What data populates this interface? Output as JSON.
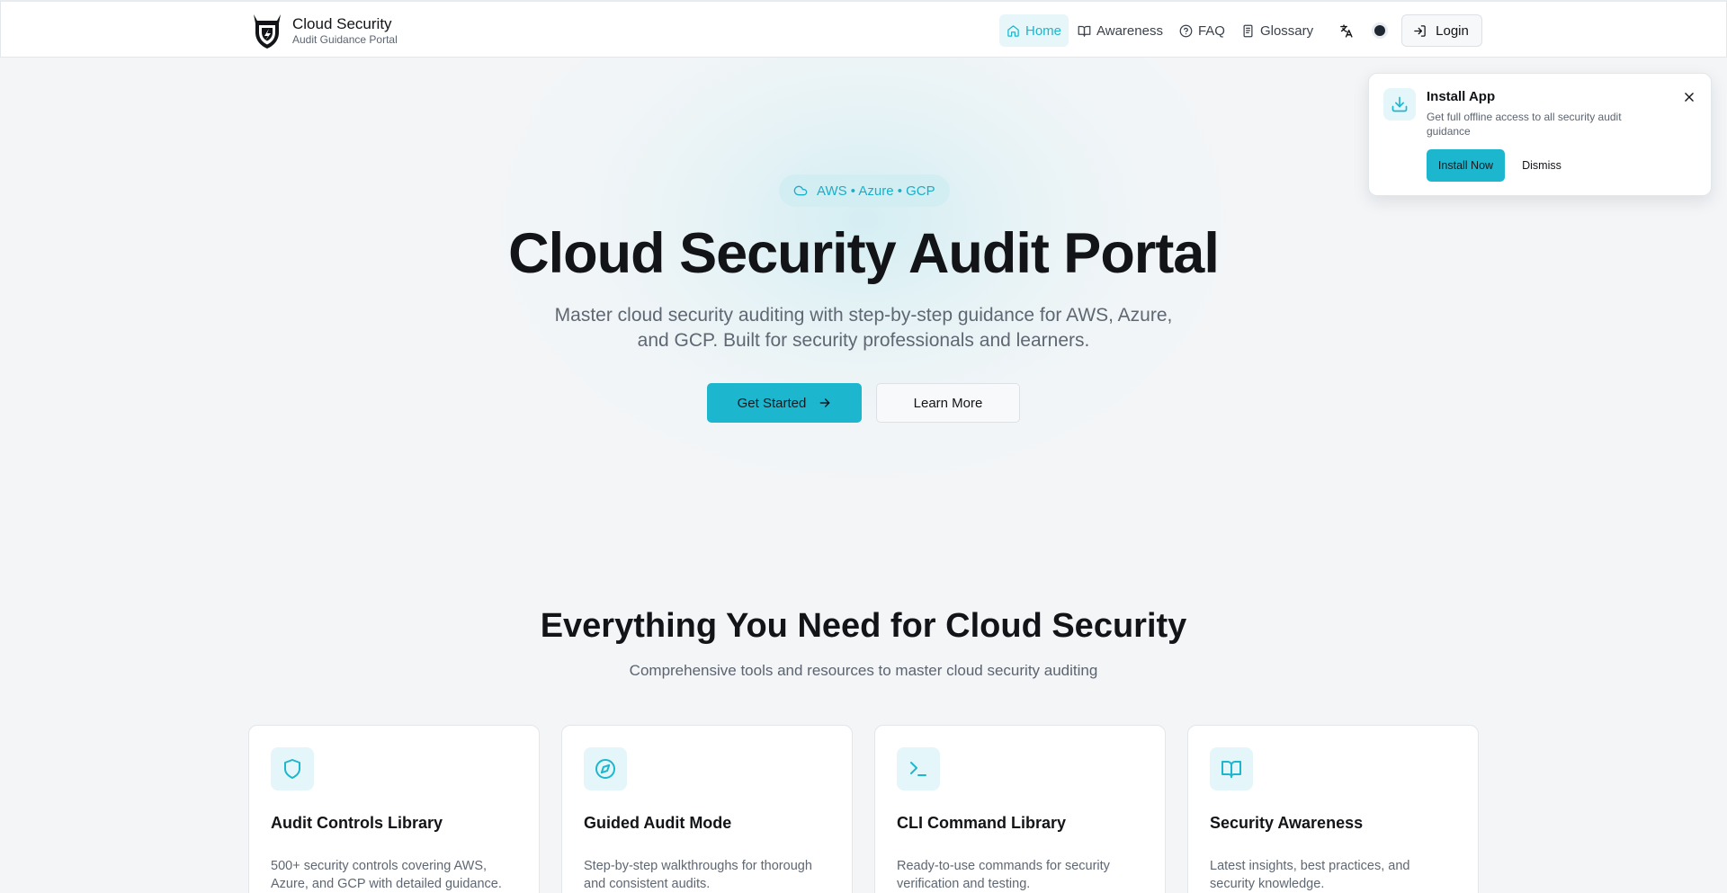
{
  "brand": {
    "title": "Cloud Security",
    "subtitle": "Audit Guidance Portal"
  },
  "nav": {
    "items": [
      {
        "label": "Home",
        "icon": "home-icon",
        "active": true
      },
      {
        "label": "Awareness",
        "icon": "book-open-icon"
      },
      {
        "label": "FAQ",
        "icon": "help-circle-icon"
      },
      {
        "label": "Glossary",
        "icon": "document-icon"
      }
    ],
    "login_label": "Login"
  },
  "hero": {
    "badge": "AWS • Azure • GCP",
    "title": "Cloud Security Audit Portal",
    "subtitle": "Master cloud security auditing with step-by-step guidance for AWS, Azure, and GCP. Built for security professionals and learners.",
    "primary_label": "Get Started",
    "secondary_label": "Learn More"
  },
  "features": {
    "title": "Everything You Need for Cloud Security",
    "subtitle": "Comprehensive tools and resources to master cloud security auditing",
    "cards": [
      {
        "title": "Audit Controls Library",
        "desc": "500+ security controls covering AWS, Azure, and GCP with detailed guidance.",
        "icon": "shield-icon"
      },
      {
        "title": "Guided Audit Mode",
        "desc": "Step-by-step walkthroughs for thorough and consistent audits.",
        "icon": "compass-icon"
      },
      {
        "title": "CLI Command Library",
        "desc": "Ready-to-use commands for security verification and testing.",
        "icon": "terminal-icon"
      },
      {
        "title": "Security Awareness",
        "desc": "Latest insights, best practices, and security knowledge.",
        "icon": "book-open-icon"
      }
    ]
  },
  "install": {
    "title": "Install App",
    "desc": "Get full offline access to all security audit guidance",
    "install_label": "Install Now",
    "dismiss_label": "Dismiss"
  },
  "colors": {
    "accent": "#1cb6cf",
    "accent_soft": "#e4f6f9",
    "text": "#121417",
    "muted": "#5f6772"
  }
}
